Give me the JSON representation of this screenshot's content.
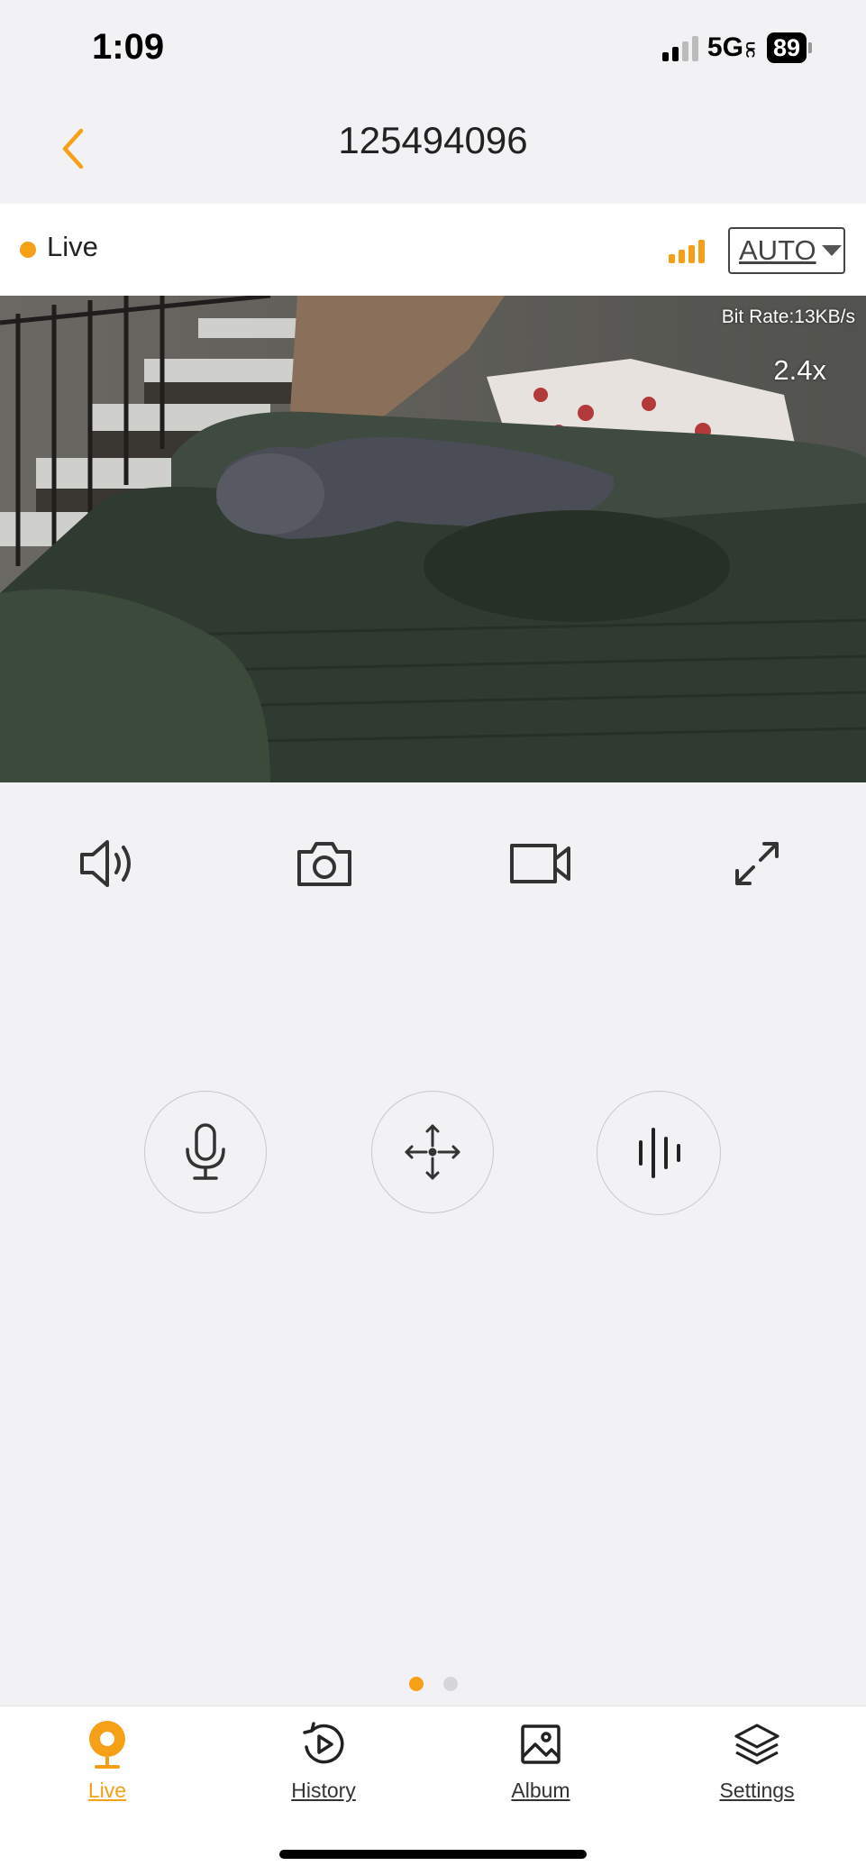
{
  "status_bar": {
    "time": "1:09",
    "network": "5G",
    "network_suffix": "UC",
    "battery": "89"
  },
  "header": {
    "title": "125494096",
    "back_icon": "chevron-left-icon"
  },
  "live_bar": {
    "status": "Live",
    "signal_icon": "signal-strength-icon",
    "quality": "AUTO"
  },
  "video": {
    "bit_rate": "Bit Rate:13KB/s",
    "zoom": "2.4x"
  },
  "toolbar": {
    "items": [
      {
        "name": "speaker",
        "icon": "speaker-icon"
      },
      {
        "name": "snapshot",
        "icon": "camera-icon"
      },
      {
        "name": "record",
        "icon": "video-record-icon"
      },
      {
        "name": "fullscreen",
        "icon": "expand-icon"
      }
    ]
  },
  "controls": {
    "items": [
      {
        "name": "talk",
        "icon": "microphone-icon"
      },
      {
        "name": "pan-tilt",
        "icon": "move-arrows-icon"
      },
      {
        "name": "voice",
        "icon": "sound-wave-icon"
      }
    ]
  },
  "pager": {
    "count": 2,
    "active": 0
  },
  "tabbar": {
    "tabs": [
      {
        "label": "Live",
        "icon": "camera-pin-icon",
        "active": true
      },
      {
        "label": "History",
        "icon": "history-play-icon",
        "active": false
      },
      {
        "label": "Album",
        "icon": "image-icon",
        "active": false
      },
      {
        "label": "Settings",
        "icon": "layers-icon",
        "active": false
      }
    ]
  },
  "colors": {
    "accent": "#f5a016",
    "background": "#f2f2f4",
    "text": "#222222"
  }
}
